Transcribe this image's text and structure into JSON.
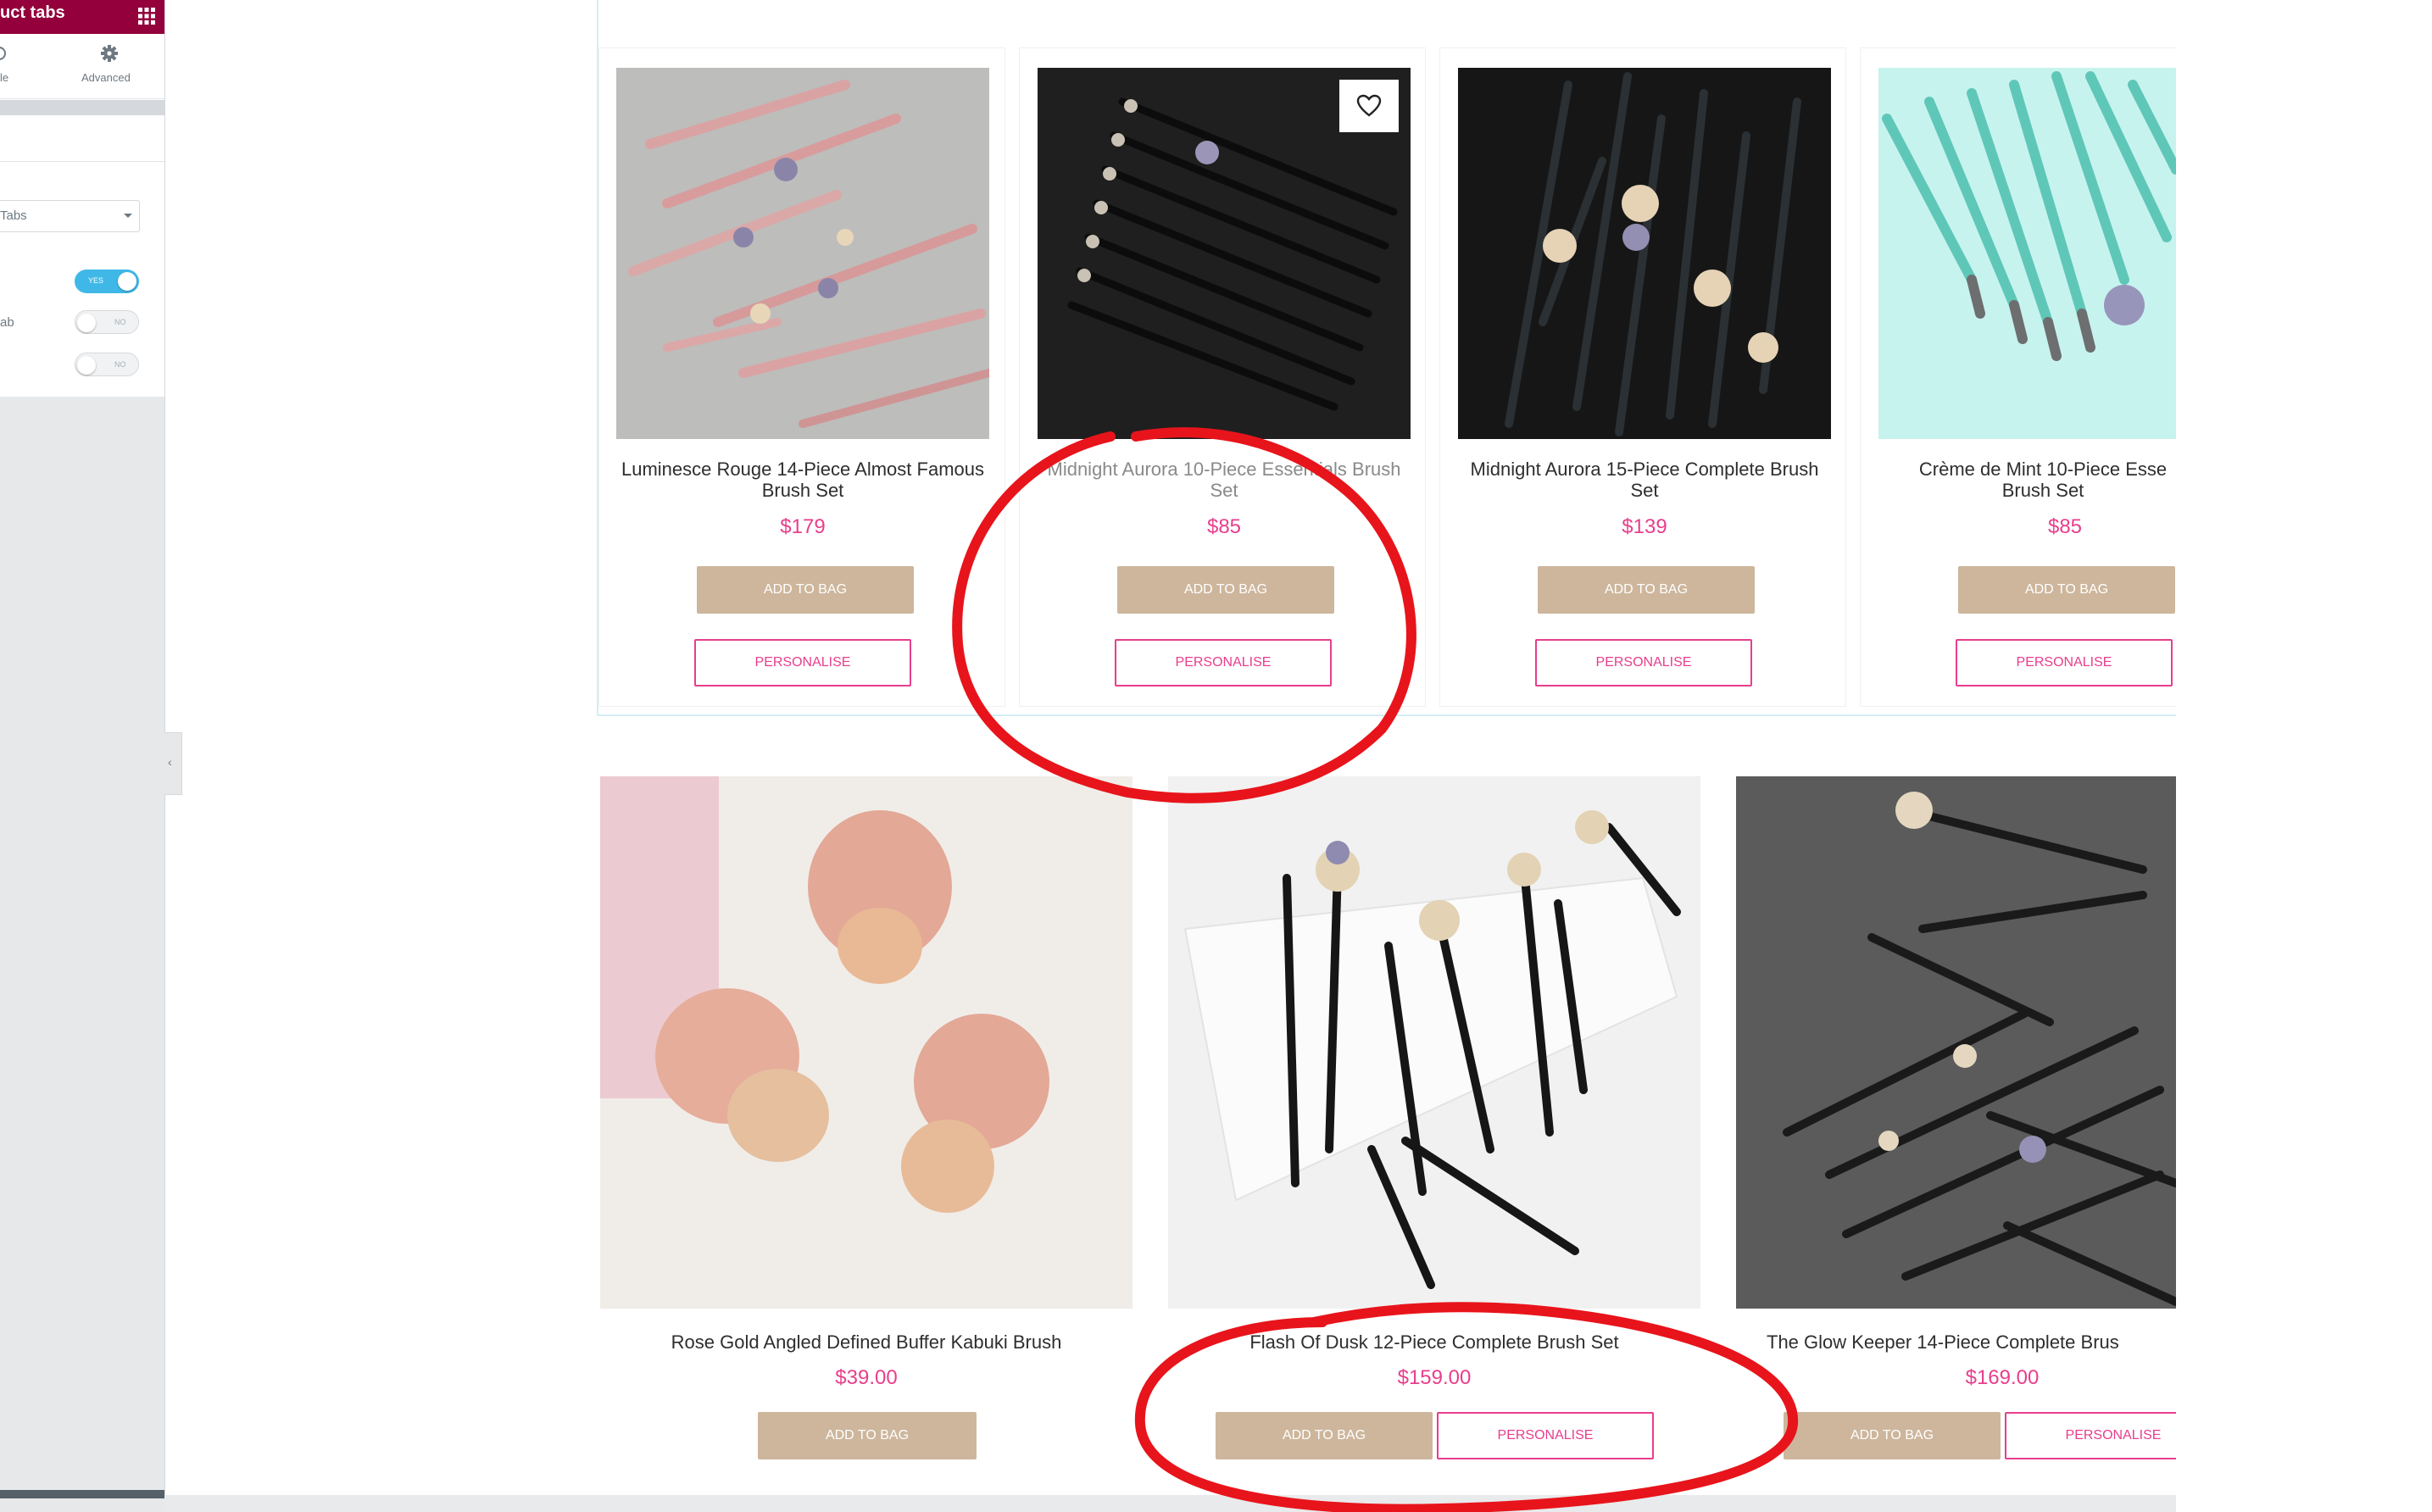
{
  "editor_panel": {
    "title": "uct tabs",
    "tabs": [
      {
        "label": "le"
      },
      {
        "label": "Advanced"
      }
    ],
    "select_value": "Tabs",
    "toggles": [
      {
        "state": "on",
        "text": "YES"
      },
      {
        "state": "off",
        "text": "NO"
      },
      {
        "state": "off",
        "text": "NO"
      }
    ],
    "control_label": "ab",
    "colors": {
      "header": "#93003c",
      "toggle_on": "#3fb8e8"
    }
  },
  "product_tabs_row": [
    {
      "title": "Luminesce Rouge 14-Piece Almost Famous Brush Set",
      "price": "$179",
      "add_label": "ADD TO BAG",
      "personalise_label": "PERSONALISE"
    },
    {
      "title": "Midnight Aurora 10-Piece Essentials Brush Set",
      "price": "$85",
      "add_label": "ADD TO BAG",
      "personalise_label": "PERSONALISE",
      "wishlist_icon": "heart-icon"
    },
    {
      "title": "Midnight Aurora 15-Piece Complete Brush Set",
      "price": "$139",
      "add_label": "ADD TO BAG",
      "personalise_label": "PERSONALISE"
    },
    {
      "title": "Crème de Mint 10-Piece Esse Brush Set",
      "price": "$85",
      "add_label": "ADD TO BAG",
      "personalise_label": "PERSONALISE"
    }
  ],
  "product_grid_row": [
    {
      "title": "Rose Gold Angled Defined Buffer Kabuki Brush",
      "price": "$39.00",
      "add_label": "ADD TO BAG"
    },
    {
      "title": "Flash Of Dusk 12-Piece Complete Brush Set",
      "price": "$159.00",
      "add_label": "ADD TO BAG",
      "personalise_label": "PERSONALISE"
    },
    {
      "title": "The Glow Keeper 14-Piece Complete Brus",
      "price": "$169.00",
      "add_label": "ADD TO BAG",
      "personalise_label": "PERSONALISE"
    }
  ],
  "colors": {
    "price": "#e83e8c",
    "add_button": "#cdb69c",
    "annotation": "#e8141b"
  }
}
